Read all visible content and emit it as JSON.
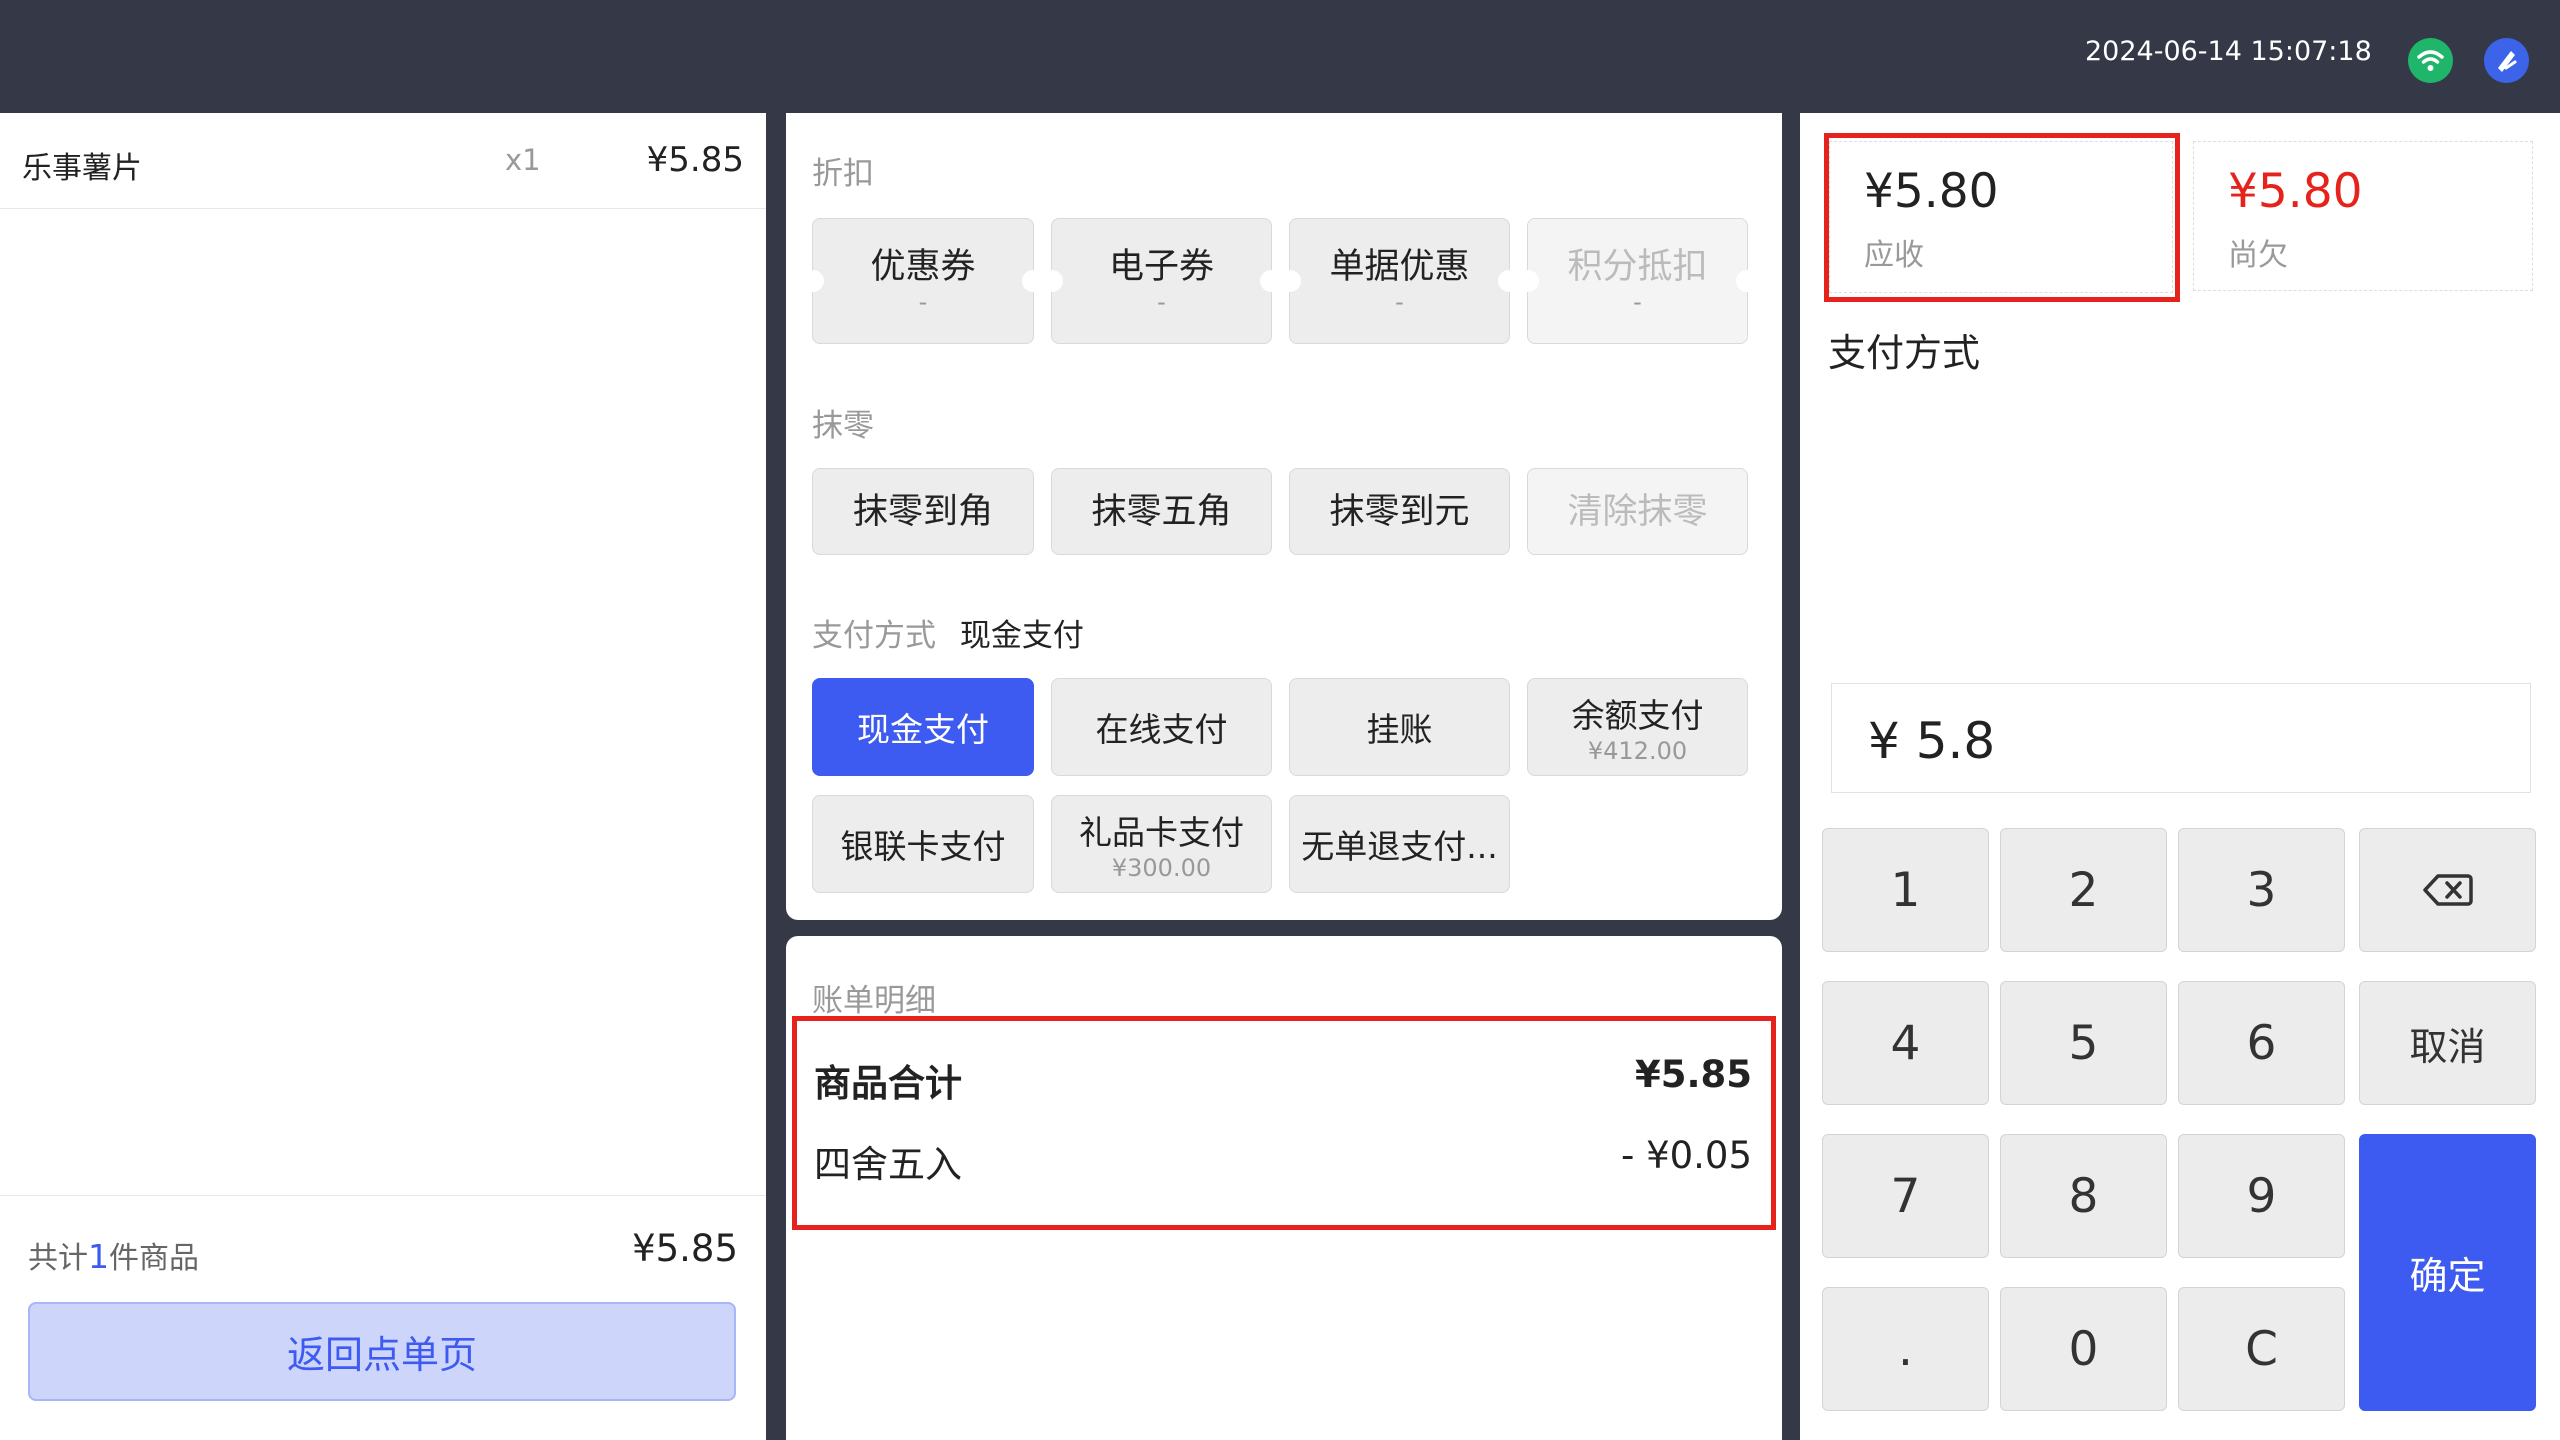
{
  "header": {
    "datetime": "2024-06-14 15:07:18",
    "wifi_icon": "wifi-icon",
    "logo_icon": "brand-logo-icon",
    "wifi_color": "#1fb56b",
    "logo_color": "#3c63e8"
  },
  "cart": {
    "items": [
      {
        "name": "乐事薯片",
        "qty": "x1",
        "price": "¥5.85"
      }
    ],
    "total_prefix": "共计",
    "total_count": "1",
    "total_suffix": "件商品",
    "total_price": "¥5.85",
    "back_button": "返回点单页"
  },
  "discount": {
    "label": "折扣",
    "buttons": [
      {
        "label": "优惠券",
        "value": "-",
        "enabled": true
      },
      {
        "label": "电子券",
        "value": "-",
        "enabled": true
      },
      {
        "label": "单据优惠",
        "value": "-",
        "enabled": true
      },
      {
        "label": "积分抵扣",
        "value": "-",
        "enabled": false
      }
    ]
  },
  "rounding": {
    "label": "抹零",
    "buttons": [
      {
        "label": "抹零到角",
        "enabled": true
      },
      {
        "label": "抹零五角",
        "enabled": true
      },
      {
        "label": "抹零到元",
        "enabled": true
      },
      {
        "label": "清除抹零",
        "enabled": false
      }
    ]
  },
  "payment": {
    "label": "支付方式",
    "selected": "现金支付",
    "buttons": [
      {
        "label": "现金支付",
        "sub": "",
        "selected": true
      },
      {
        "label": "在线支付",
        "sub": ""
      },
      {
        "label": "挂账",
        "sub": ""
      },
      {
        "label": "余额支付",
        "sub": "¥412.00"
      },
      {
        "label": "银联卡支付",
        "sub": ""
      },
      {
        "label": "礼品卡支付",
        "sub": "¥300.00"
      },
      {
        "label": "无单退支付...",
        "sub": ""
      }
    ]
  },
  "bill": {
    "label": "账单明细",
    "rows": [
      {
        "name": "商品合计",
        "value": "¥5.85"
      },
      {
        "name": "四舍五入",
        "value": "- ¥0.05"
      }
    ]
  },
  "summary": {
    "receivable_amount": "¥5.80",
    "receivable_label": "应收",
    "owed_amount": "¥5.80",
    "owed_label": "尚欠",
    "owed_color": "#e5231c",
    "pay_method_title": "支付方式"
  },
  "keypad": {
    "input_value": "¥ 5.8",
    "keys": [
      "1",
      "2",
      "3",
      "4",
      "5",
      "6",
      "7",
      "8",
      "9",
      ".",
      "0",
      "C"
    ],
    "backspace_icon": "backspace-icon",
    "cancel": "取消",
    "confirm": "确定"
  },
  "accent_color": "#3d5af1"
}
